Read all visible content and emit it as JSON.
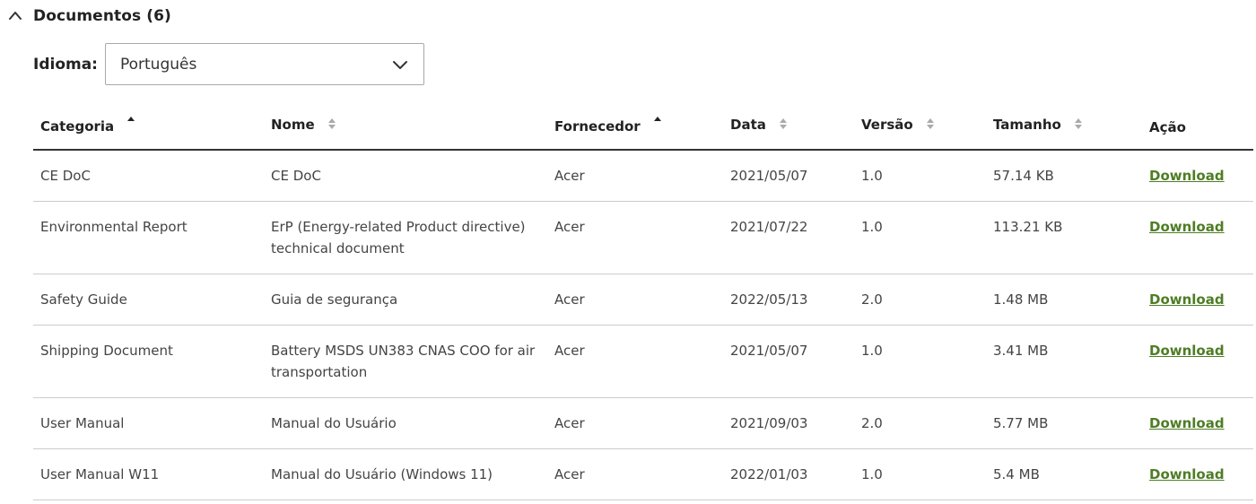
{
  "section": {
    "title": "Documentos (6)"
  },
  "language": {
    "label": "Idioma:",
    "selected": "Português"
  },
  "table": {
    "columns": [
      {
        "label": "Categoria",
        "sort": "asc"
      },
      {
        "label": "Nome",
        "sort": "none"
      },
      {
        "label": "Fornecedor",
        "sort": "asc"
      },
      {
        "label": "Data",
        "sort": "none"
      },
      {
        "label": "Versão",
        "sort": "none"
      },
      {
        "label": "Tamanho",
        "sort": "none"
      },
      {
        "label": "Ação",
        "sort": null
      }
    ],
    "rows": [
      {
        "category": "CE DoC",
        "name": "CE DoC",
        "supplier": "Acer",
        "date": "2021/05/07",
        "version": "1.0",
        "size": "57.14 KB",
        "action": "Download"
      },
      {
        "category": "Environmental Report",
        "name": "ErP (Energy-related Product directive) technical document",
        "supplier": "Acer",
        "date": "2021/07/22",
        "version": "1.0",
        "size": "113.21 KB",
        "action": "Download"
      },
      {
        "category": "Safety Guide",
        "name": "Guia de segurança",
        "supplier": "Acer",
        "date": "2022/05/13",
        "version": "2.0",
        "size": "1.48 MB",
        "action": "Download"
      },
      {
        "category": "Shipping Document",
        "name": "Battery MSDS UN383 CNAS COO for air transportation",
        "supplier": "Acer",
        "date": "2021/05/07",
        "version": "1.0",
        "size": "3.41 MB",
        "action": "Download"
      },
      {
        "category": "User Manual",
        "name": "Manual do Usuário",
        "supplier": "Acer",
        "date": "2021/09/03",
        "version": "2.0",
        "size": "5.77 MB",
        "action": "Download"
      },
      {
        "category": "User Manual W11",
        "name": "Manual do Usuário (Windows 11)",
        "supplier": "Acer",
        "date": "2022/01/03",
        "version": "1.0",
        "size": "5.4 MB",
        "action": "Download"
      }
    ]
  },
  "colors": {
    "link": "#4e7d25",
    "header_rule": "#333333",
    "row_rule": "#cccccc"
  },
  "icons": {
    "collapse": "chevron-up-icon",
    "dropdown": "chevron-down-icon",
    "sort_asc": "sort-asc-icon",
    "sort_none": "sort-both-icon"
  }
}
